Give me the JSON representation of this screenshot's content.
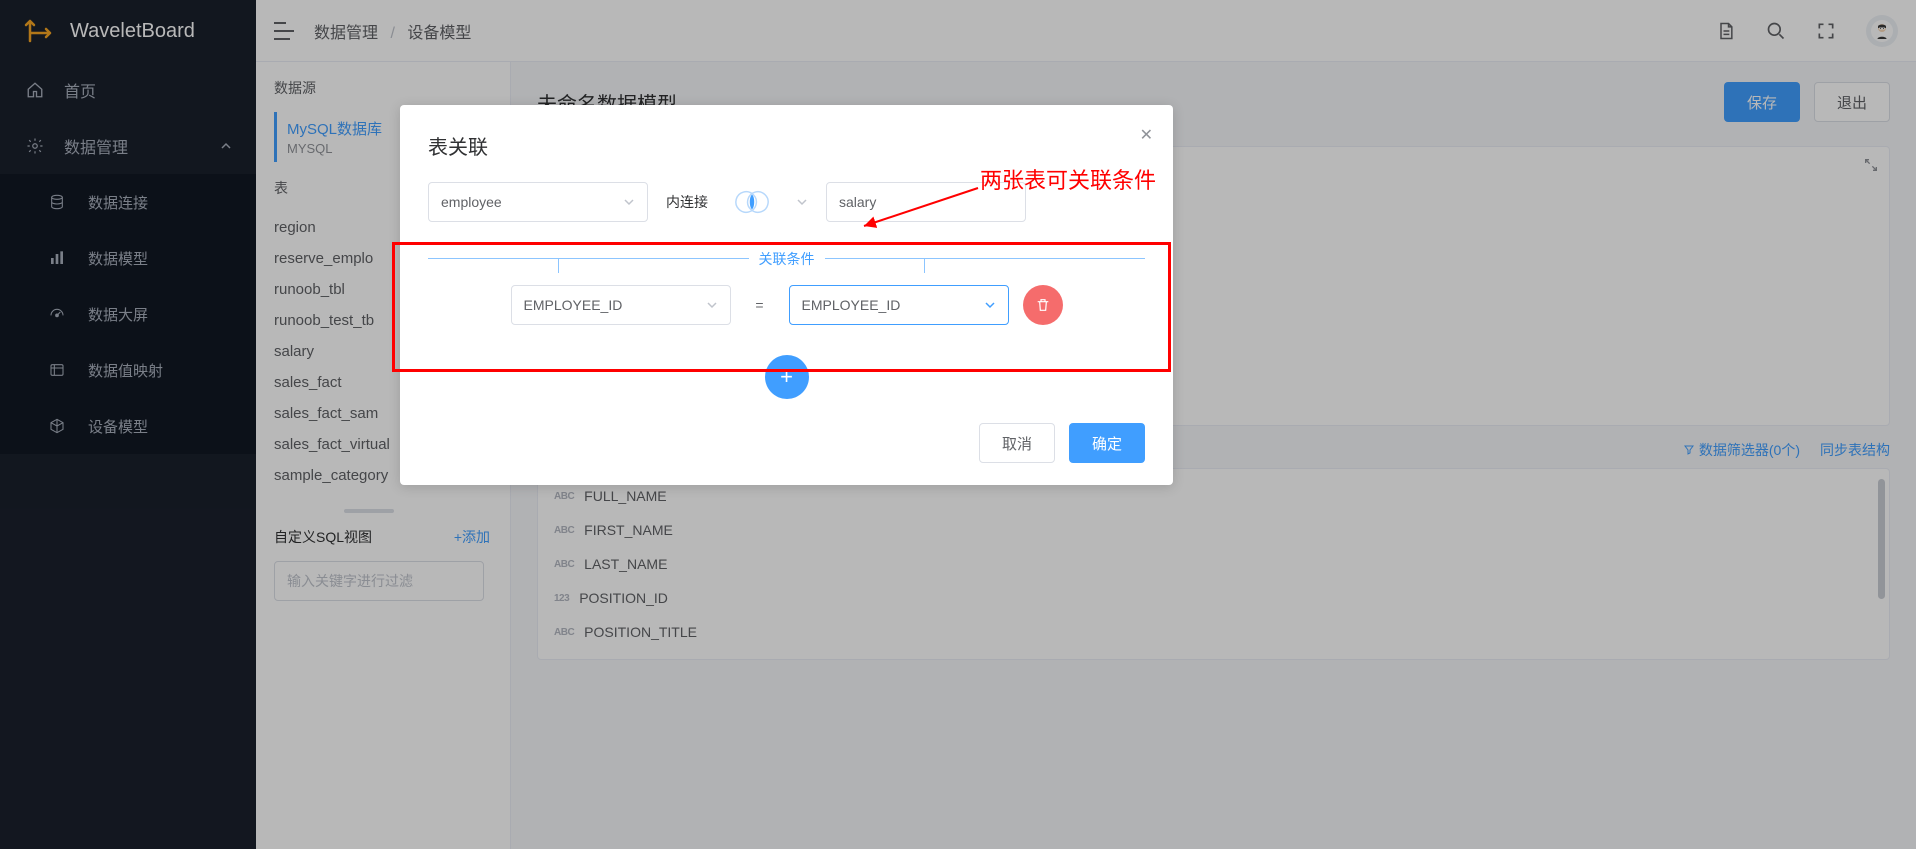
{
  "brand": "WaveletBoard",
  "sidebar": {
    "home": "首页",
    "data": "数据管理",
    "items": [
      "数据连接",
      "数据模型",
      "数据大屏",
      "数据值映射",
      "设备模型"
    ]
  },
  "breadcrumb": {
    "a": "数据管理",
    "b": "设备模型"
  },
  "buttons": {
    "save": "保存",
    "exit": "退出",
    "cancel": "取消",
    "ok": "确定"
  },
  "datasource": {
    "heading": "数据源",
    "name": "MySQL数据库",
    "type": "MYSQL",
    "tables_heading": "表",
    "tables": [
      "region",
      "reserve_emplo",
      "runoob_tbl",
      "runoob_test_tb",
      "salary",
      "sales_fact",
      "sales_fact_sam",
      "sales_fact_virtual",
      "sample_category"
    ],
    "sql_view": "自定义SQL视图",
    "add": "+添加",
    "filter_placeholder": "输入关键字进行过滤"
  },
  "model": {
    "title": "未命名数据模型",
    "filter_link": "数据筛选器(0个)",
    "sync_link": "同步表结构",
    "fields": [
      {
        "t": "ABC",
        "n": "FULL_NAME"
      },
      {
        "t": "ABC",
        "n": "FIRST_NAME"
      },
      {
        "t": "ABC",
        "n": "LAST_NAME"
      },
      {
        "t": "123",
        "n": "POSITION_ID"
      },
      {
        "t": "ABC",
        "n": "POSITION_TITLE"
      }
    ]
  },
  "modal": {
    "title": "表关联",
    "left_table": "employee",
    "join_type": "内连接",
    "right_table": "salary",
    "section": "关联条件",
    "left_field": "EMPLOYEE_ID",
    "op": "=",
    "right_field": "EMPLOYEE_ID"
  },
  "annotation": "两张表可关联条件"
}
